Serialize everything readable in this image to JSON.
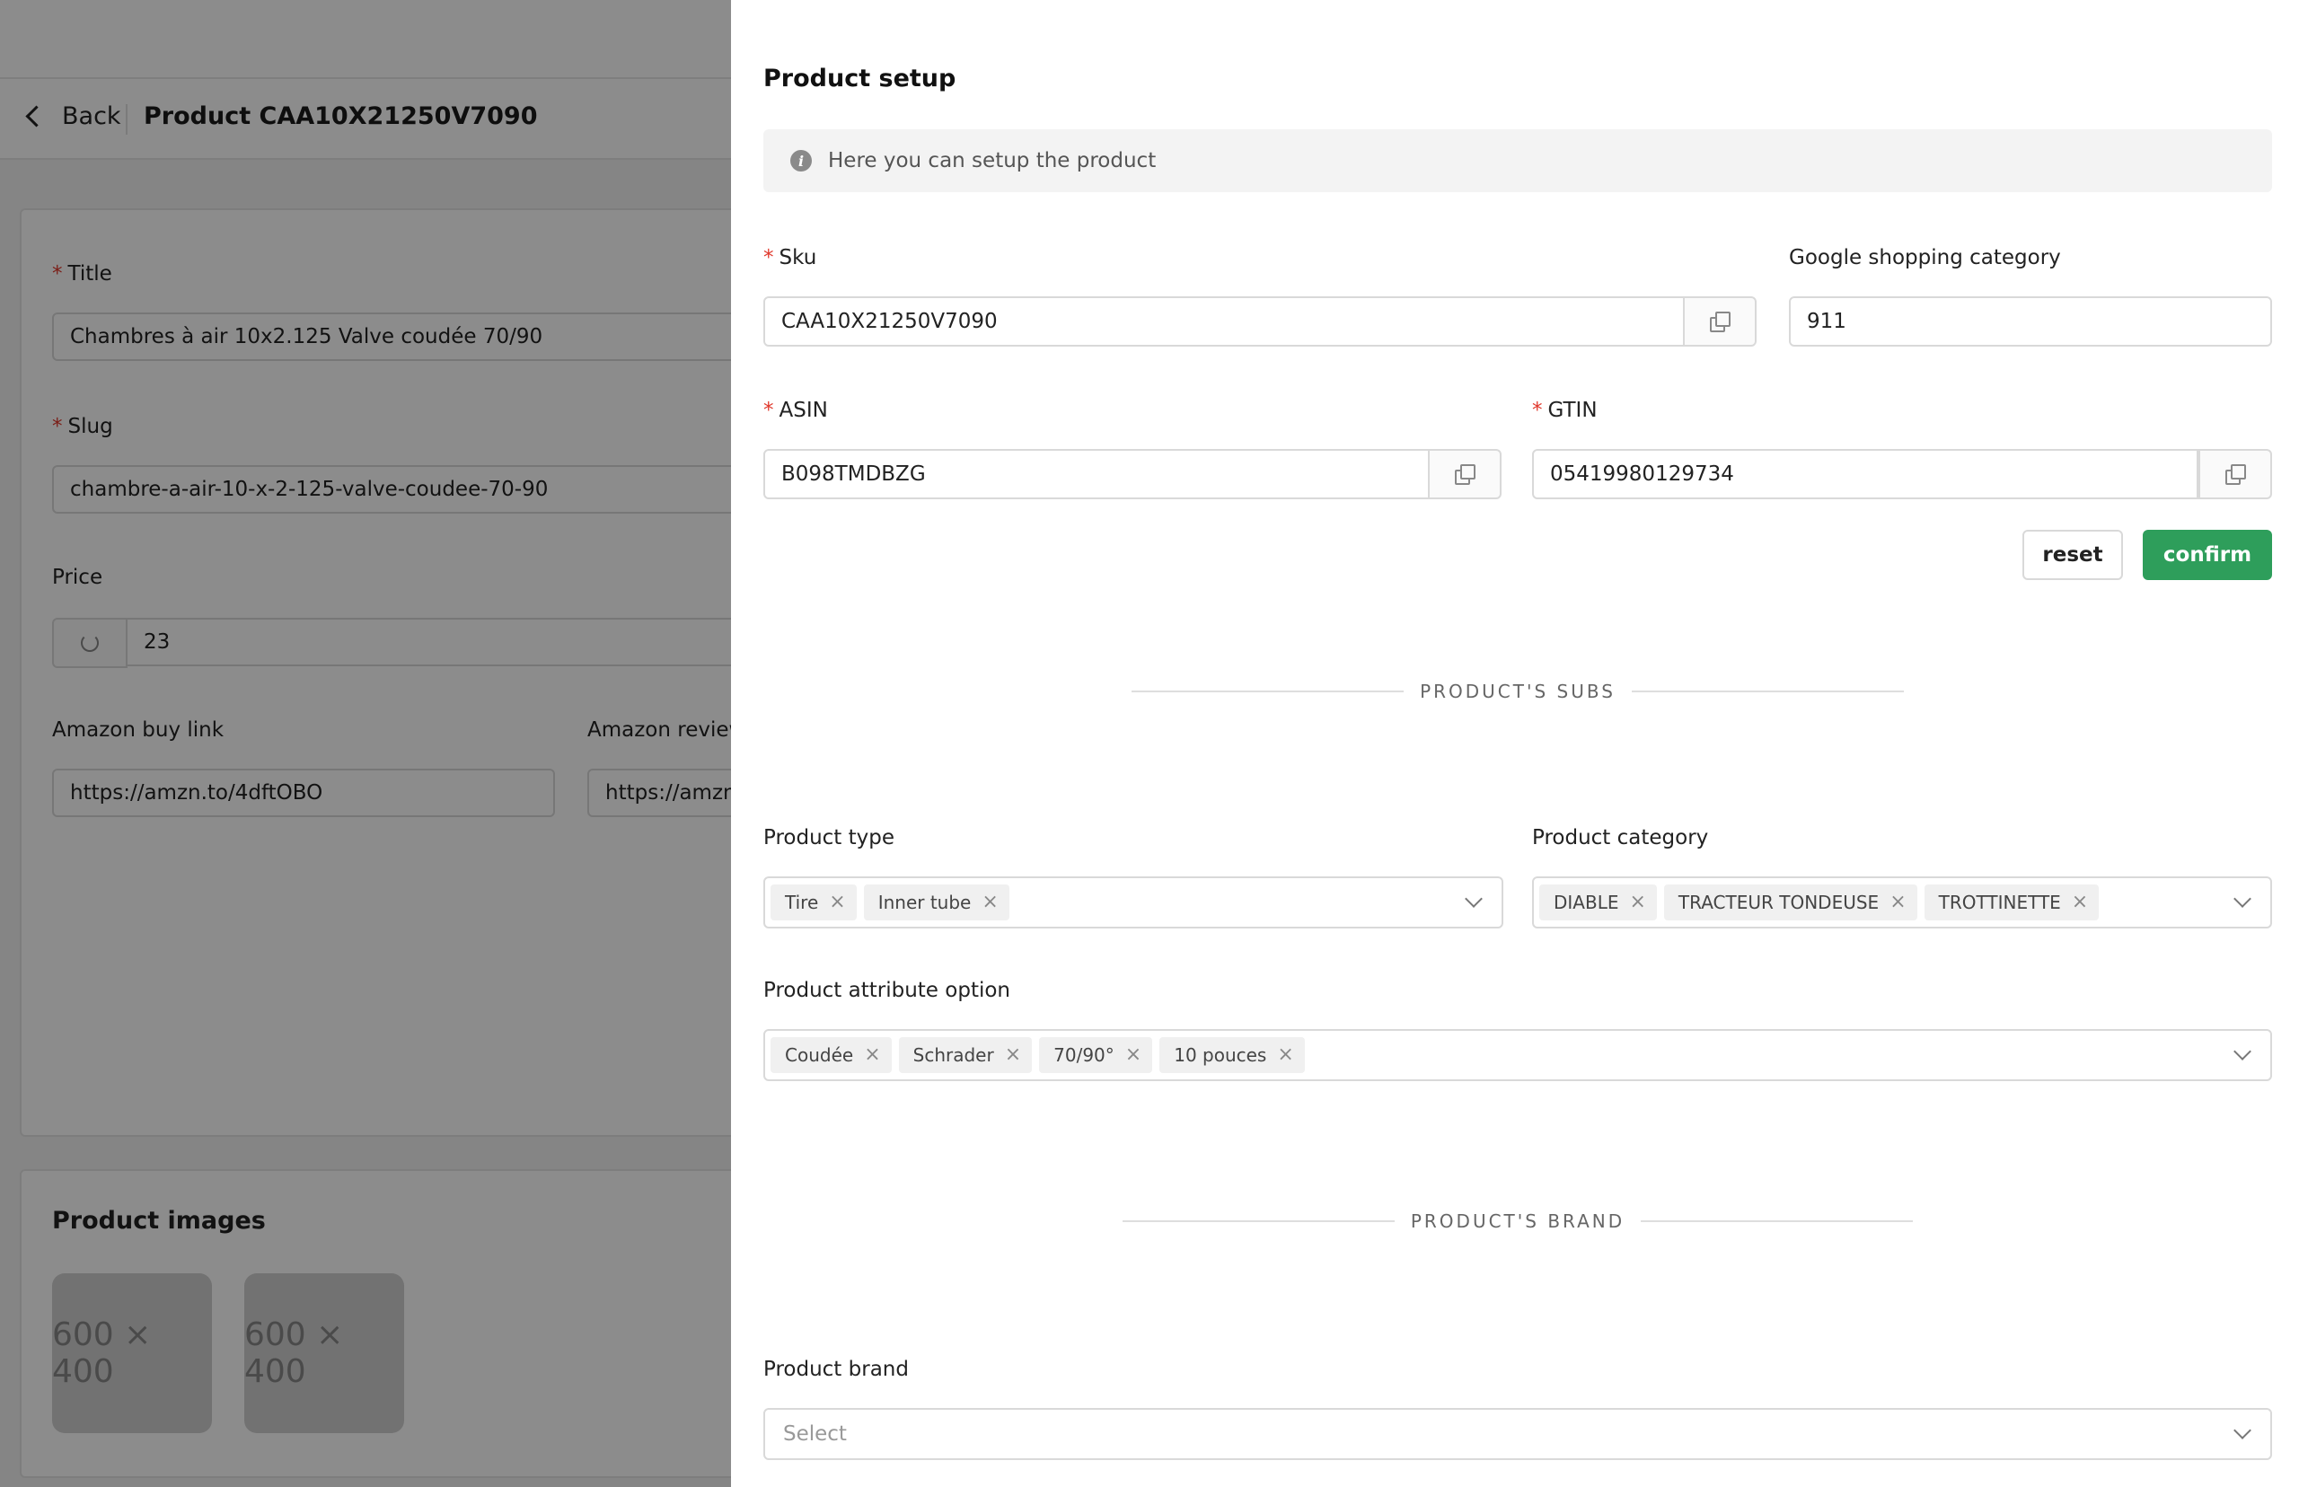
{
  "background": {
    "back_label": "Back",
    "product_heading": "Product CAA10X21250V7090",
    "fields": {
      "title_label": "Title",
      "title_value": "Chambres à air 10x2.125 Valve coudée 70/90",
      "slug_label": "Slug",
      "slug_value": "chambre-a-air-10-x-2-125-valve-coudee-70-90",
      "price_label": "Price",
      "price_value": "23",
      "amazon_buy_label": "Amazon buy link",
      "amazon_buy_value": "https://amzn.to/4dftOBO",
      "amazon_review_label": "Amazon review",
      "amazon_review_value": "https://amzn"
    },
    "images_title": "Product images",
    "image_placeholders": [
      "600 × 400",
      "600 × 400"
    ]
  },
  "drawer": {
    "title": "Product setup",
    "info_text": "Here you can setup the product",
    "sku": {
      "label": "Sku",
      "value": "CAA10X21250V7090",
      "required": true
    },
    "google_category": {
      "label": "Google shopping category",
      "value": "911"
    },
    "asin": {
      "label": "ASIN",
      "value": "B098TMDBZG",
      "required": true
    },
    "gtin": {
      "label": "GTIN",
      "value": "05419980129734",
      "required": true
    },
    "reset_label": "reset",
    "confirm_label": "confirm",
    "subs_divider": "PRODUCT'S SUBS",
    "product_type": {
      "label": "Product type",
      "tags": [
        "Tire",
        "Inner tube"
      ]
    },
    "product_category": {
      "label": "Product category",
      "tags": [
        "DIABLE",
        "TRACTEUR TONDEUSE",
        "TROTTINETTE"
      ]
    },
    "attribute_option": {
      "label": "Product attribute option",
      "tags": [
        "Coudée",
        "Schrader",
        "70/90°",
        "10 pouces"
      ]
    },
    "brand_divider": "PRODUCT'S BRAND",
    "product_brand": {
      "label": "Product brand",
      "placeholder": "Select"
    }
  },
  "colors": {
    "accent_green": "#2e9e5b",
    "required_red": "#e0382c"
  },
  "icons": [
    "info-icon",
    "copy-icon",
    "chevron-down-icon",
    "close-icon",
    "chevron-left-icon",
    "refresh-icon"
  ]
}
